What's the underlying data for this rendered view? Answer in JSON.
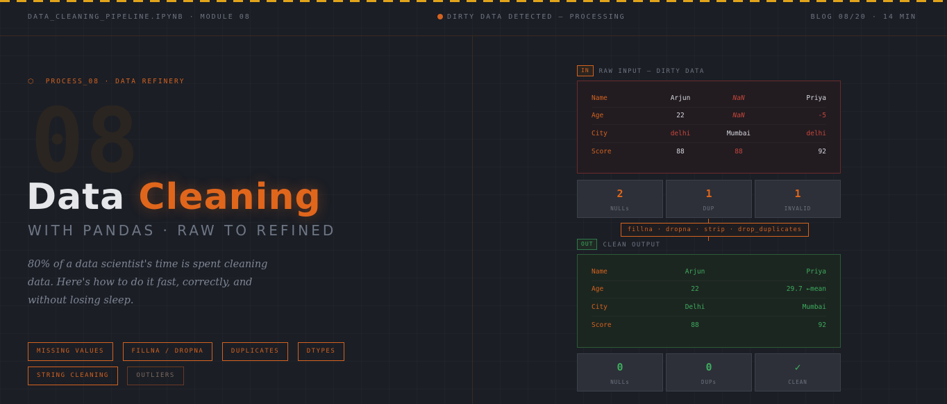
{
  "topbar": {
    "file": "DATA_CLEANING_PIPELINE.IPYNB · MODULE 08",
    "status": "DIRTY DATA DETECTED — PROCESSING",
    "meta": "BLOG 08/20 · 14 MIN"
  },
  "hero": {
    "eyebrow_icon": "hexagon-icon",
    "eyebrow": "PROCESS_08 · DATA REFINERY",
    "big_number": "08",
    "title_word1": "Data",
    "title_word2": "Cleaning",
    "subtitle": "WITH PANDAS · RAW TO REFINED",
    "lede": "80% of a data scientist's time is spent cleaning data. Here's how to do it fast, correctly, and without losing sleep.",
    "tags": [
      "MISSING VALUES",
      "FILLNA / DROPNA",
      "DUPLICATES",
      "DTYPES",
      "STRING CLEANING",
      "OUTLIERS"
    ]
  },
  "raw": {
    "badge": "IN",
    "label": "RAW INPUT — DIRTY DATA",
    "rows": [
      {
        "key": "Name",
        "cells": [
          "Arjun",
          "NaN",
          "Priya"
        ]
      },
      {
        "key": "Age",
        "cells": [
          "22",
          "NaN",
          "-5"
        ]
      },
      {
        "key": "City",
        "cells": [
          "delhi",
          "Mumbai",
          "delhi"
        ]
      },
      {
        "key": "Score",
        "cells": [
          "88",
          "88",
          "92"
        ]
      }
    ],
    "stats": [
      {
        "value": "2",
        "label": "NULLs"
      },
      {
        "value": "1",
        "label": "DUP"
      },
      {
        "value": "1",
        "label": "INVALID"
      }
    ]
  },
  "ops": "fillna · dropna · strip · drop_duplicates",
  "clean": {
    "badge": "OUT",
    "label": "CLEAN OUTPUT",
    "rows": [
      {
        "key": "Name",
        "cells": [
          "Arjun",
          "Priya"
        ]
      },
      {
        "key": "Age",
        "cells": [
          "22",
          "29.7 ←mean"
        ]
      },
      {
        "key": "City",
        "cells": [
          "Delhi",
          "Mumbai"
        ]
      },
      {
        "key": "Score",
        "cells": [
          "88",
          "92"
        ]
      }
    ],
    "stats": [
      {
        "value": "0",
        "label": "NULLs"
      },
      {
        "value": "0",
        "label": "DUPs"
      },
      {
        "value": "✓",
        "label": "CLEAN"
      }
    ]
  },
  "colors": {
    "accent": "#e0661c",
    "danger": "#c7453a",
    "success": "#3dab5e",
    "background": "#1b1e25"
  }
}
